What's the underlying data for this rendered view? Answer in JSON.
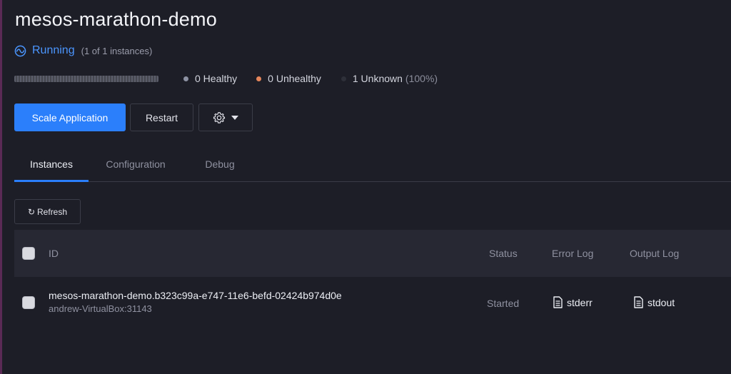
{
  "app": {
    "title": "mesos-marathon-demo",
    "status_label": "Running",
    "instances_label": "(1 of 1 instances)"
  },
  "health": {
    "healthy": "0 Healthy",
    "unhealthy": "0 Unhealthy",
    "unknown": "1 Unknown",
    "unknown_pct": "(100%)"
  },
  "actions": {
    "scale_label": "Scale Application",
    "restart_label": "Restart",
    "more_icon": "gear-icon"
  },
  "tabs": [
    {
      "label": "Instances",
      "active": true
    },
    {
      "label": "Configuration",
      "active": false
    },
    {
      "label": "Debug",
      "active": false
    }
  ],
  "toolbar": {
    "refresh_glyph": "↻",
    "refresh_label": "Refresh"
  },
  "table": {
    "columns": {
      "id": "ID",
      "status": "Status",
      "error_log": "Error Log",
      "output_log": "Output Log"
    },
    "rows": [
      {
        "id": "mesos-marathon-demo.b323c99a-e747-11e6-befd-02424b974d0e",
        "host": "andrew-VirtualBox:31143",
        "status": "Started",
        "error_log": "stderr",
        "output_log": "stdout"
      }
    ]
  },
  "colors": {
    "accent": "#2b7ffb",
    "running": "#4b96ff",
    "unhealthy": "#e5865b",
    "background": "#1d1e27"
  }
}
